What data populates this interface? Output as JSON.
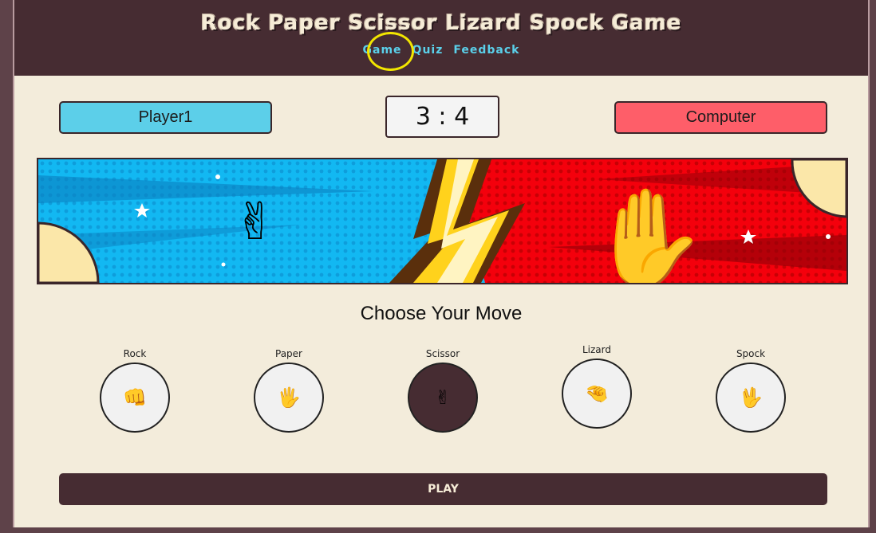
{
  "header": {
    "title": "Rock Paper Scissor Lizard Spock Game",
    "nav": [
      "Game",
      "Quiz",
      "Feedback"
    ]
  },
  "scoreboard": {
    "player": "Player1",
    "score": "3 : 4",
    "computer": "Computer"
  },
  "banner": {
    "player_hand_icon": "✌",
    "computer_hand_icon": "✋"
  },
  "choose_title": "Choose Your Move",
  "moves": [
    {
      "label": "Rock",
      "icon": "👊",
      "selected": false
    },
    {
      "label": "Paper",
      "icon": "🖐",
      "selected": false
    },
    {
      "label": "Scissor",
      "icon": "✌",
      "selected": true
    },
    {
      "label": "Lizard",
      "icon": "🤏",
      "selected": false
    },
    {
      "label": "Spock",
      "icon": "🖖",
      "selected": false
    }
  ],
  "play_label": "PLAY",
  "colors": {
    "header_bg": "#462c32",
    "page_bg": "#f3ecdb",
    "player": "#5ccfe9",
    "computer": "#fe5e69",
    "nav_link": "#5ad0ea",
    "highlight_ring": "#f2e600"
  }
}
